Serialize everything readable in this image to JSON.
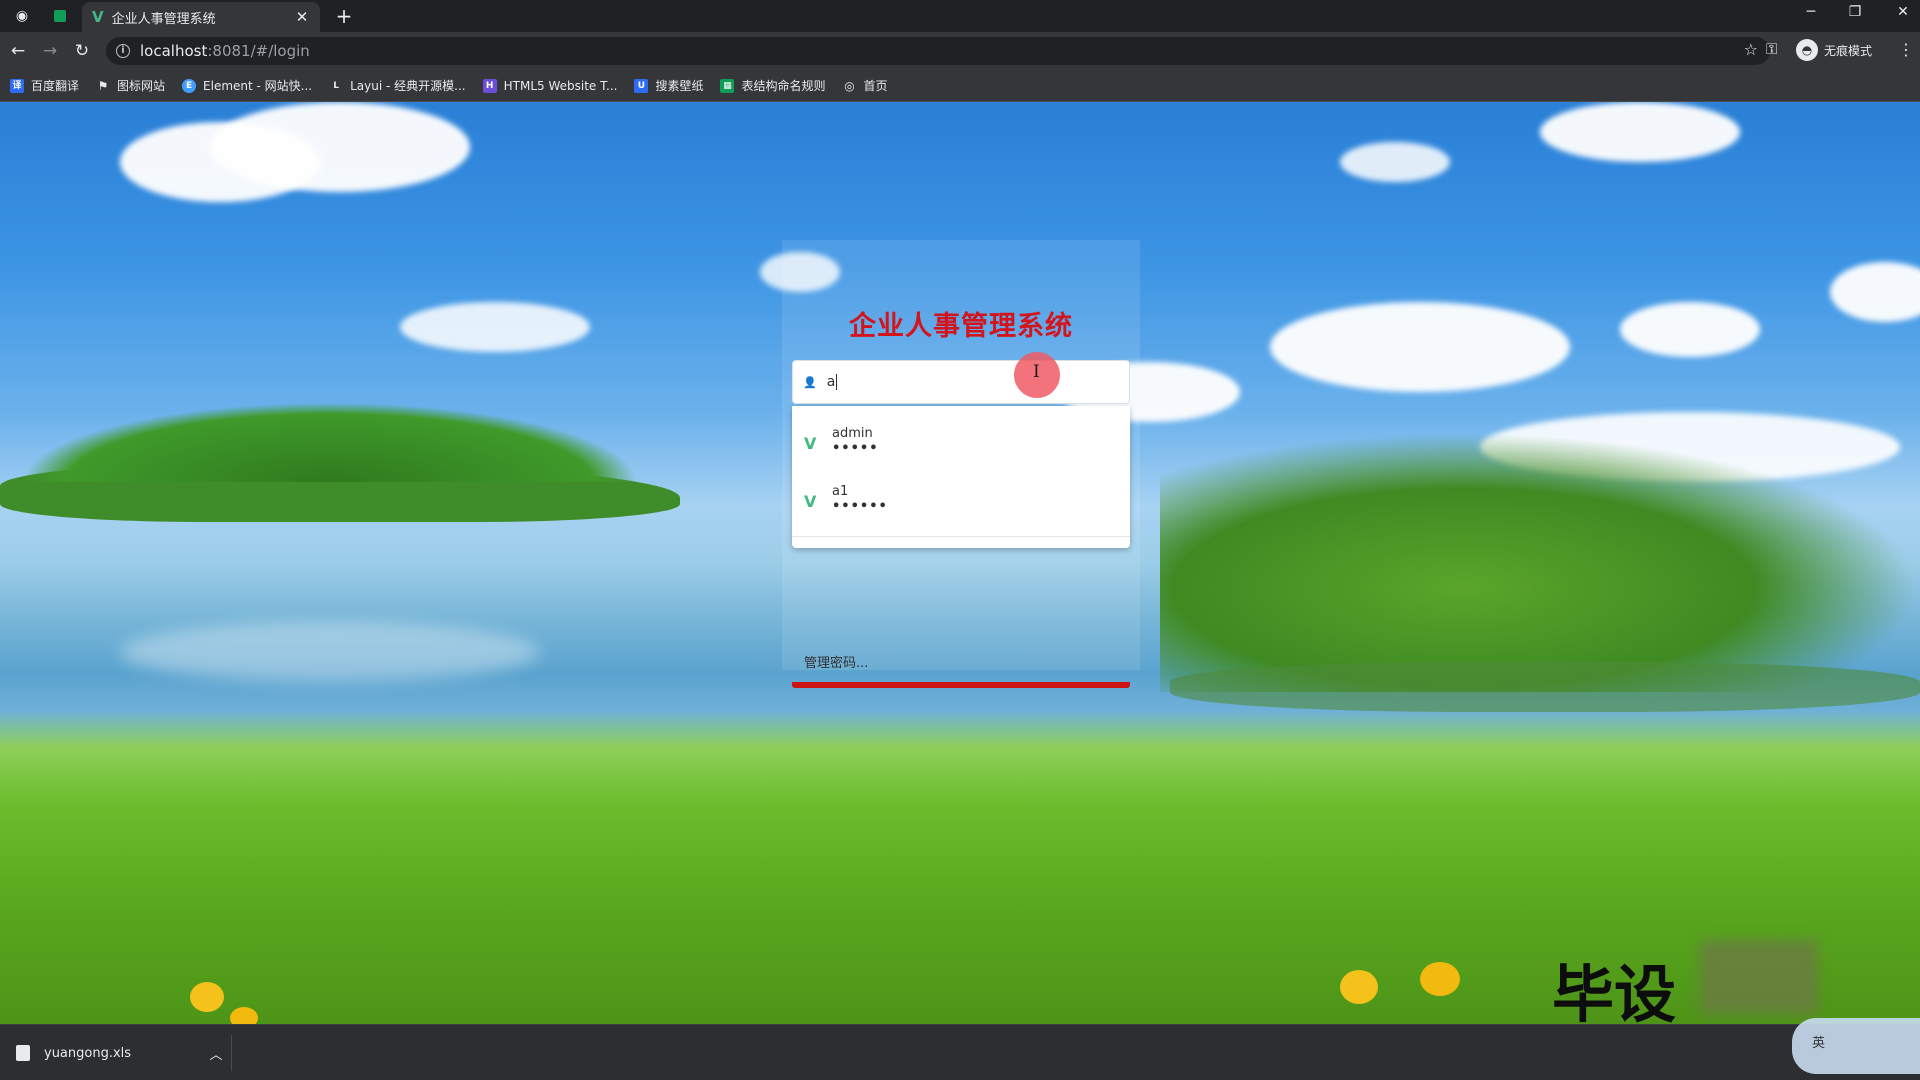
{
  "browser": {
    "tab_title": "企业人事管理系统",
    "url_host": "localhost",
    "url_rest": ":8081/#/login",
    "profile_label": "无痕模式",
    "bookmarks": [
      {
        "label": "百度翻译",
        "icon": "translate-icon",
        "color": "#2f6cf6"
      },
      {
        "label": "图标网站",
        "icon": "flag-icon",
        "color": "#35363a"
      },
      {
        "label": "Element - 网站快...",
        "icon": "element-icon",
        "color": "#409eff"
      },
      {
        "label": "Layui - 经典开源模...",
        "icon": "layui-icon",
        "color": "#35363a"
      },
      {
        "label": "HTML5 Website T...",
        "icon": "html5-icon",
        "color": "#6b4fd8"
      },
      {
        "label": "搜素壁纸",
        "icon": "wallpaper-icon",
        "color": "#2f6cf6"
      },
      {
        "label": "表结构命名规则",
        "icon": "sheet-icon",
        "color": "#0f9d58"
      },
      {
        "label": "首页",
        "icon": "globe-icon",
        "color": "#35363a"
      }
    ]
  },
  "login": {
    "title": "企业人事管理系统",
    "username_value": "a",
    "title_color": "#d4141c",
    "accent_bar_color": "#cc1414"
  },
  "autofill": {
    "suggestions": [
      {
        "username": "admin",
        "password_mask": "•••••"
      },
      {
        "username": "a1",
        "password_mask": "••••••"
      }
    ],
    "manage_label": "管理密码..."
  },
  "watermark": "毕设",
  "downloads": {
    "file_name": "yuangong.xls"
  },
  "ime": {
    "label": "英"
  }
}
